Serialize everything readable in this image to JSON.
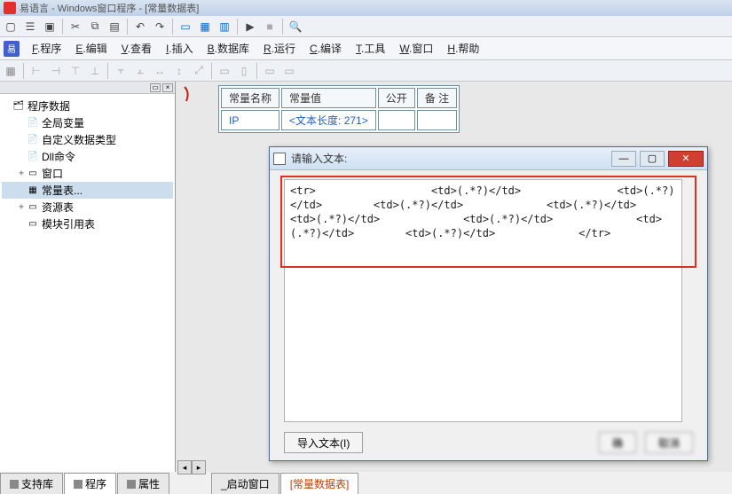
{
  "window": {
    "title": "易语言 - Windows窗口程序 - [常量数据表]"
  },
  "menubar": {
    "items": [
      {
        "u": "F",
        "label": ".程序"
      },
      {
        "u": "E",
        "label": ".编辑"
      },
      {
        "u": "V",
        "label": ".查看"
      },
      {
        "u": "I",
        "label": ".插入"
      },
      {
        "u": "B",
        "label": ".数据库"
      },
      {
        "u": "R",
        "label": ".运行"
      },
      {
        "u": "C",
        "label": ".编译"
      },
      {
        "u": "T",
        "label": ".工具"
      },
      {
        "u": "W",
        "label": ".窗口"
      },
      {
        "u": "H",
        "label": ".帮助"
      }
    ]
  },
  "tree": {
    "root": "程序数据",
    "nodes": [
      {
        "icon": "📄",
        "label": "全局变量"
      },
      {
        "icon": "📄",
        "label": "自定义数据类型"
      },
      {
        "icon": "📄",
        "label": "Dll命令"
      },
      {
        "icon": "▭",
        "label": "窗口",
        "exp": "+"
      },
      {
        "icon": "▦",
        "label": "常量表...",
        "sel": true
      },
      {
        "icon": "▭",
        "label": "资源表",
        "exp": "+"
      },
      {
        "icon": "▭",
        "label": "模块引用表"
      }
    ]
  },
  "const_table": {
    "headers": [
      "常量名称",
      "常量值",
      "公开",
      "备 注"
    ],
    "rows": [
      {
        "name": "IP",
        "value": "<文本长度: 271>",
        "public": "",
        "remark": ""
      }
    ]
  },
  "dialog": {
    "title": "请输入文本:",
    "text": "<tr>                  <td>(.*?)</td>               <td>(.*?)</td>        <td>(.*?)</td>             <td>(.*?)</td>               <td>(.*?)</td>             <td>(.*?)</td>             <td>(.*?)</td>        <td>(.*?)</td>             </tr>",
    "import_btn": "导入文本(I)",
    "ok_btn": "确",
    "cancel_btn": "取消"
  },
  "bottom_tabs_left": [
    {
      "label": "支持库"
    },
    {
      "label": "程序"
    },
    {
      "label": "属性"
    }
  ],
  "bottom_tabs_right": [
    {
      "label": "_启动窗口"
    },
    {
      "label": "[常量数据表]",
      "active": true
    }
  ]
}
